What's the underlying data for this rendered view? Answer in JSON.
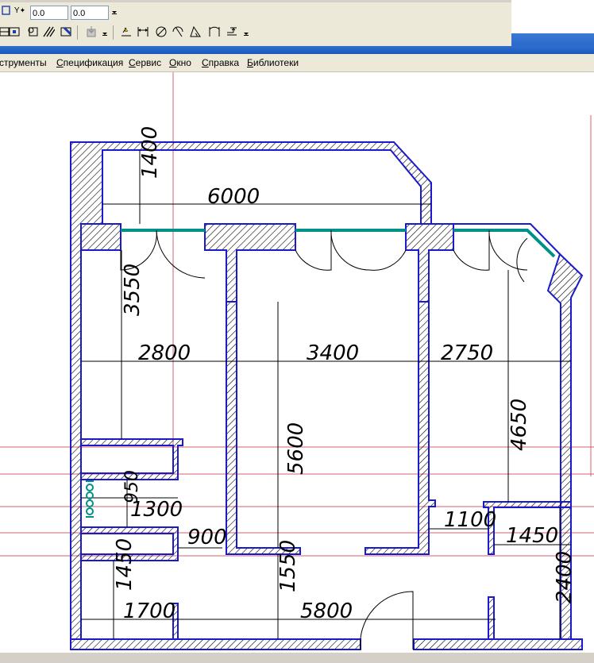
{
  "toolbar": {
    "y_label": "Y",
    "x_value": "0.0",
    "y_value": "0.0"
  },
  "menu": {
    "items": [
      {
        "pre": "",
        "ul": "",
        "post": "струменты"
      },
      {
        "pre": "",
        "ul": "С",
        "post": "пецификация"
      },
      {
        "pre": "",
        "ul": "С",
        "post": "ервис"
      },
      {
        "pre": "",
        "ul": "О",
        "post": "кно"
      },
      {
        "pre": "",
        "ul": "С",
        "post": "правка"
      },
      {
        "pre": "",
        "ul": "Б",
        "post": "иблиотеки"
      }
    ]
  },
  "drawing": {
    "dimensions": {
      "d1400": "1400",
      "d6000": "6000",
      "d3550": "3550",
      "d2800": "2800",
      "d3400": "3400",
      "d2750": "2750",
      "d4650": "4650",
      "d5600": "5600",
      "d950": "950",
      "d1300": "1300",
      "d900": "900",
      "d1100": "1100",
      "d1450a": "1450",
      "d1450b": "1450",
      "d1700": "1700",
      "d1550": "1550",
      "d5800": "5800",
      "d2400": "2400"
    },
    "colors": {
      "wall_outline": "#1a1acc",
      "hatch": "#000000",
      "window": "#00908a",
      "guide_line": "#d06070"
    }
  }
}
